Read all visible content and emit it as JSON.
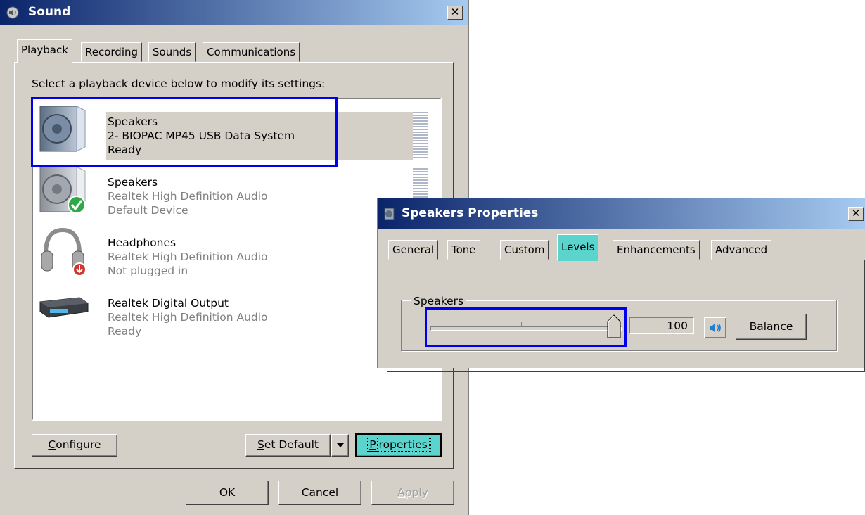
{
  "sound_window": {
    "title": "Sound",
    "close_glyph": "✕",
    "tabs": [
      {
        "label": "Playback",
        "active": true
      },
      {
        "label": "Recording",
        "active": false
      },
      {
        "label": "Sounds",
        "active": false
      },
      {
        "label": "Communications",
        "active": false
      }
    ],
    "instruction": "Select a playback device below to modify its settings:",
    "devices": [
      {
        "name": "Speakers",
        "line2": "2- BIOPAC MP45 USB Data System",
        "status": "Ready",
        "icon": "speaker-icon",
        "selected": true
      },
      {
        "name": "Speakers",
        "line2": "Realtek High Definition Audio",
        "status": "Default Device",
        "icon": "speaker-default-icon",
        "selected": false
      },
      {
        "name": "Headphones",
        "line2": "Realtek High Definition Audio",
        "status": "Not plugged in",
        "icon": "headphones-icon",
        "selected": false
      },
      {
        "name": "Realtek Digital Output",
        "line2": "Realtek High Definition Audio",
        "status": "Ready",
        "icon": "digital-output-icon",
        "selected": false
      }
    ],
    "buttons": {
      "configure_prefix": "",
      "configure_hot": "C",
      "configure_rest": "onfigure",
      "set_default_hot": "S",
      "set_default_rest": "et Default",
      "properties_hot": "P",
      "properties_rest": "roperties",
      "ok": "OK",
      "cancel": "Cancel",
      "apply_hot": "A",
      "apply_rest": "pply"
    }
  },
  "properties_window": {
    "title": "Speakers Properties",
    "close_glyph": "✕",
    "tabs": [
      {
        "label": "General",
        "active": false
      },
      {
        "label": "Tone",
        "active": false
      },
      {
        "label": "Custom",
        "active": false
      },
      {
        "label": "Levels",
        "active": true
      },
      {
        "label": "Enhancements",
        "active": false
      },
      {
        "label": "Advanced",
        "active": false
      }
    ],
    "group_label": "Speakers",
    "level_value": "100",
    "level_fraction": 1.0,
    "balance_label": "Balance"
  },
  "colors": {
    "window_bg": "#d4d0c8",
    "title_gradient_start": "#0a246a",
    "title_gradient_end": "#a6caf0",
    "highlight_accent": "#5ad4cc",
    "annotation_box": "#0000ee"
  }
}
